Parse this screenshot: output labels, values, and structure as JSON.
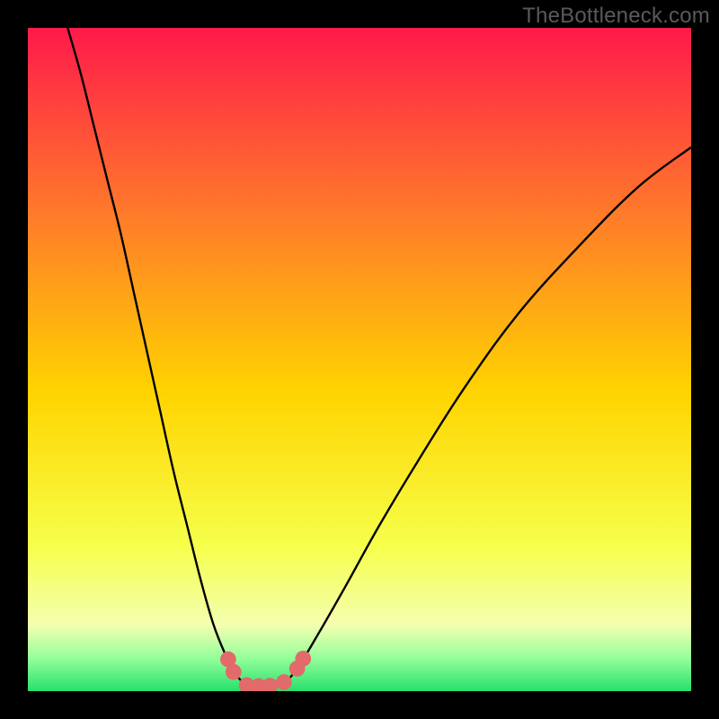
{
  "watermark": "TheBottleneck.com",
  "colors": {
    "frame": "#000000",
    "grad_top": "#ff1a4b",
    "grad_mid_upper": "#ff7a2a",
    "grad_mid": "#ffd400",
    "grad_lower": "#f6ff4a",
    "grad_pale": "#f4ffb0",
    "grad_green_light": "#95ff9a",
    "grad_green": "#27e06d",
    "curve": "#000000",
    "marker_fill": "#e26a6a",
    "marker_stroke": "#c84f4f"
  },
  "chart_data": {
    "type": "line",
    "title": "",
    "xlabel": "",
    "ylabel": "",
    "xlim": [
      0,
      100
    ],
    "ylim": [
      0,
      100
    ],
    "series": [
      {
        "name": "left-branch",
        "x": [
          6,
          8,
          10,
          12,
          14,
          16,
          18,
          20,
          22,
          24,
          26,
          28,
          30,
          31,
          32.5,
          34
        ],
        "y": [
          100,
          93,
          85,
          77,
          69,
          60,
          51,
          42,
          33,
          25,
          17,
          10,
          5,
          3,
          1.3,
          0.8
        ]
      },
      {
        "name": "right-branch",
        "x": [
          37.5,
          39,
          41,
          44,
          48,
          53,
          59,
          66,
          74,
          83,
          92,
          100
        ],
        "y": [
          0.8,
          1.5,
          4,
          9,
          16,
          25,
          35,
          46,
          57,
          67,
          76,
          82
        ]
      }
    ],
    "markers": [
      {
        "x": 30.2,
        "y": 4.8
      },
      {
        "x": 31.0,
        "y": 2.9
      },
      {
        "x": 33.0,
        "y": 0.9
      },
      {
        "x": 34.8,
        "y": 0.75
      },
      {
        "x": 36.5,
        "y": 0.8
      },
      {
        "x": 38.6,
        "y": 1.35
      },
      {
        "x": 40.6,
        "y": 3.4
      },
      {
        "x": 41.5,
        "y": 4.9
      }
    ],
    "marker_radius_pct": 1.2
  }
}
